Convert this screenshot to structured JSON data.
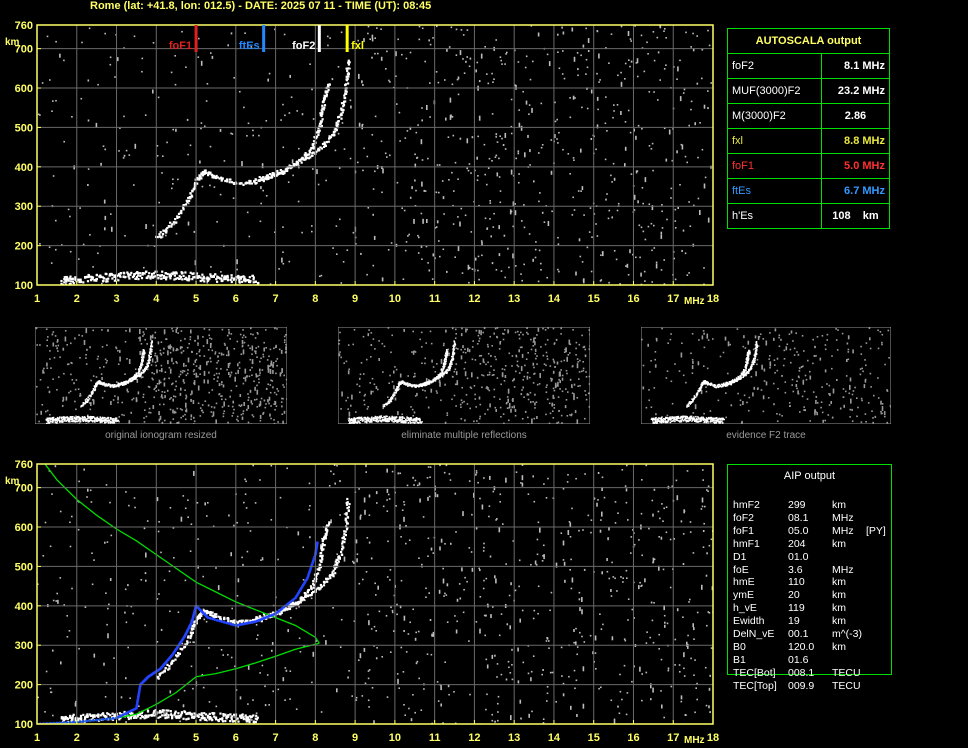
{
  "header": {
    "title": "Rome (lat: +41.8, lon: 012.5) - DATE: 2025 07 11 - TIME (UT): 08:45"
  },
  "colors": {
    "axis": "#ffff66",
    "grid": "#6a6a6a",
    "noise": "#bdbdbd",
    "trace": "#ffffff",
    "fof1": "#e02020",
    "ftes": "#2288ff",
    "fof2": "#ffffff",
    "fxl": "#ffff00",
    "profile": "#00dd00",
    "aip_trace": "#2244ff",
    "box": "#00e000"
  },
  "axes": {
    "y_ticks": [
      "100",
      "200",
      "300",
      "400",
      "500",
      "600",
      "700",
      "760"
    ],
    "y_unit": "km",
    "x_ticks": [
      "1",
      "2",
      "3",
      "4",
      "5",
      "6",
      "7",
      "8",
      "9",
      "10",
      "11",
      "12",
      "13",
      "14",
      "15",
      "16",
      "17",
      "18"
    ],
    "x_unit": "MHz"
  },
  "markers": [
    {
      "label": "foF1",
      "freq": 5.0,
      "color": "#e02020"
    },
    {
      "label": "ftEs",
      "freq": 6.7,
      "color": "#2288ff"
    },
    {
      "label": "foF2",
      "freq": 8.1,
      "color": "#ffffff"
    },
    {
      "label": "fxl",
      "freq": 8.8,
      "color": "#ffff00"
    }
  ],
  "autoscala": {
    "title": "AUTOSCALA output",
    "rows": [
      {
        "label": "foF2",
        "value": "8.1 MHz",
        "color": "#ffffff"
      },
      {
        "label": "MUF(3000)F2",
        "value": "23.2 MHz",
        "color": "#ffffff"
      },
      {
        "label": "M(3000)F2",
        "value": "2.86",
        "color": "#ffffff"
      },
      {
        "label": "fxl",
        "value": "8.8 MHz",
        "color": "#e8e840"
      },
      {
        "label": "foF1",
        "value": "5.0 MHz",
        "color": "#ff3030"
      },
      {
        "label": "ftEs",
        "value": "6.7 MHz",
        "color": "#3399ff"
      },
      {
        "label": "h'Es",
        "value": "108    km",
        "color": "#ffffff"
      }
    ]
  },
  "thumbnails": [
    {
      "caption": "original ionogram resized"
    },
    {
      "caption": "eliminate multiple reflections"
    },
    {
      "caption": "evidence F2 trace"
    }
  ],
  "aip": {
    "title": "AIP output",
    "rows": [
      {
        "name": "hmF2",
        "value": "299",
        "unit": "km",
        "flag": ""
      },
      {
        "name": "foF2",
        "value": "08.1",
        "unit": "MHz",
        "flag": ""
      },
      {
        "name": "foF1",
        "value": "05.0",
        "unit": "MHz",
        "flag": "[PY]"
      },
      {
        "name": "hmF1",
        "value": "204",
        "unit": "km",
        "flag": ""
      },
      {
        "name": "D1",
        "value": "01.0",
        "unit": "",
        "flag": ""
      },
      {
        "name": "foE",
        "value": "3.6",
        "unit": "MHz",
        "flag": ""
      },
      {
        "name": "hmE",
        "value": "110",
        "unit": "km",
        "flag": ""
      },
      {
        "name": "ymE",
        "value": "20",
        "unit": "km",
        "flag": ""
      },
      {
        "name": "h_vE",
        "value": "119",
        "unit": "km",
        "flag": ""
      },
      {
        "name": "Ewidth",
        "value": "19",
        "unit": "km",
        "flag": ""
      },
      {
        "name": "DelN_vE",
        "value": "00.1",
        "unit": "m^(-3)",
        "flag": ""
      },
      {
        "name": "B0",
        "value": "120.0",
        "unit": "km",
        "flag": ""
      },
      {
        "name": "B1",
        "value": "01.6",
        "unit": "",
        "flag": ""
      },
      {
        "name": "TEC[Bot]",
        "value": "008.1",
        "unit": "TECU",
        "flag": ""
      },
      {
        "name": "TEC[Top]",
        "value": "009.9",
        "unit": "TECU",
        "flag": ""
      }
    ]
  },
  "chart_data": [
    {
      "type": "scatter",
      "title": "ionogram with AUTOSCALA markers",
      "xlabel": "MHz",
      "ylabel": "km",
      "xlim": [
        1,
        18
      ],
      "ylim": [
        100,
        760
      ],
      "grid": true,
      "series": [
        {
          "name": "E trace",
          "points": [
            [
              1.6,
              112
            ],
            [
              2.0,
              117
            ],
            [
              2.5,
              120
            ],
            [
              3.0,
              123
            ],
            [
              3.5,
              126
            ],
            [
              4.0,
              128
            ],
            [
              4.5,
              126
            ],
            [
              5.0,
              123
            ],
            [
              5.5,
              120
            ],
            [
              6.0,
              118
            ],
            [
              6.5,
              117
            ]
          ]
        },
        {
          "name": "F1 trace",
          "points": [
            [
              4.0,
              220
            ],
            [
              4.4,
              260
            ],
            [
              4.8,
              320
            ],
            [
              5.0,
              370
            ],
            [
              5.2,
              390
            ],
            [
              5.5,
              375
            ],
            [
              6.0,
              360
            ],
            [
              6.5,
              365
            ],
            [
              7.0,
              380
            ],
            [
              7.5,
              410
            ],
            [
              7.9,
              450
            ],
            [
              8.1,
              510
            ],
            [
              8.2,
              570
            ],
            [
              8.3,
              610
            ]
          ]
        },
        {
          "name": "F2 x trace",
          "points": [
            [
              6.5,
              370
            ],
            [
              7.0,
              385
            ],
            [
              7.5,
              410
            ],
            [
              8.0,
              440
            ],
            [
              8.4,
              480
            ],
            [
              8.6,
              530
            ],
            [
              8.75,
              600
            ],
            [
              8.8,
              670
            ]
          ]
        }
      ]
    },
    {
      "type": "line",
      "title": "AIP profile",
      "xlabel": "MHz",
      "ylabel": "km",
      "xlim": [
        1,
        18
      ],
      "ylim": [
        100,
        760
      ],
      "grid": true,
      "series": [
        {
          "name": "profile top",
          "points": [
            [
              1.2,
              760
            ],
            [
              1.5,
              720
            ],
            [
              2.0,
              670
            ],
            [
              2.5,
              630
            ],
            [
              3.0,
              595
            ],
            [
              3.5,
              565
            ],
            [
              4.0,
              530
            ],
            [
              4.5,
              495
            ],
            [
              5.0,
              460
            ],
            [
              5.5,
              435
            ],
            [
              6.0,
              410
            ],
            [
              6.5,
              390
            ],
            [
              7.0,
              370
            ],
            [
              7.5,
              350
            ],
            [
              8.0,
              320
            ],
            [
              8.1,
              305
            ]
          ]
        },
        {
          "name": "profile bottom",
          "points": [
            [
              8.1,
              305
            ],
            [
              7.5,
              290
            ],
            [
              7.0,
              272
            ],
            [
              6.5,
              255
            ],
            [
              6.0,
              240
            ],
            [
              5.5,
              228
            ],
            [
              5.0,
              220
            ],
            [
              4.5,
              180
            ],
            [
              4.0,
              150
            ],
            [
              3.5,
              125
            ],
            [
              3.0,
              115
            ],
            [
              2.0,
              105
            ],
            [
              1.0,
              100
            ]
          ]
        },
        {
          "name": "AIP fit",
          "points": [
            [
              1.0,
              100
            ],
            [
              2.0,
              105
            ],
            [
              3.0,
              115
            ],
            [
              3.5,
              140
            ],
            [
              3.6,
              200
            ],
            [
              3.8,
              220
            ],
            [
              4.1,
              240
            ],
            [
              4.4,
              275
            ],
            [
              4.7,
              320
            ],
            [
              4.9,
              360
            ],
            [
              5.0,
              400
            ],
            [
              5.3,
              370
            ],
            [
              6.0,
              350
            ],
            [
              6.5,
              360
            ],
            [
              7.0,
              380
            ],
            [
              7.5,
              420
            ],
            [
              7.8,
              470
            ],
            [
              8.0,
              530
            ],
            [
              8.05,
              560
            ]
          ]
        }
      ]
    }
  ]
}
